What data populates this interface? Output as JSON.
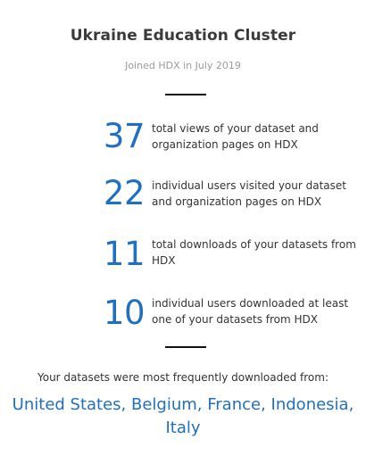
{
  "header": {
    "org_name": "Ukraine Education Cluster",
    "joined": "Joined HDX in July 2019"
  },
  "stats": [
    {
      "value": "37",
      "label": "total views of your dataset and organization pages on HDX"
    },
    {
      "value": "22",
      "label": "individual users visited your dataset and organization pages on HDX"
    },
    {
      "value": "11",
      "label": "total downloads of your datasets from HDX"
    },
    {
      "value": "10",
      "label": "individual users downloaded at least one of your datasets from HDX"
    }
  ],
  "downloads": {
    "intro": "Your datasets were most frequently downloaded from:",
    "countries": "United States, Belgium, France, Indonesia, Italy"
  },
  "colors": {
    "accent": "#1f70c1",
    "text": "#333333",
    "muted": "#9a9a9a",
    "divider": "#111111"
  }
}
